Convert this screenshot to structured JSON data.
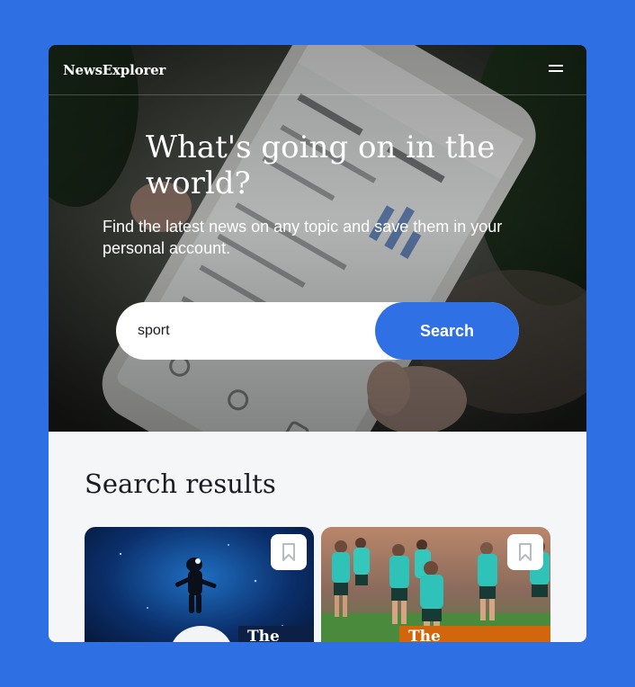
{
  "header": {
    "logo": "NewsExplorer",
    "menu_icon": "hamburger-menu-icon"
  },
  "hero": {
    "title": "What's going on in the world?",
    "subtitle": "Find the latest news on any topic and save them in your personal account."
  },
  "search": {
    "value": "sport",
    "button_label": "Search"
  },
  "results": {
    "title": "Search results",
    "cards": [
      {
        "bookmark_icon": "bookmark-icon",
        "source_tag": "The"
      },
      {
        "bookmark_icon": "bookmark-icon",
        "source_tag": "The"
      }
    ]
  },
  "colors": {
    "page_background": "#2f6fe4",
    "accent": "#2f71e5",
    "results_background": "#f5f6f7",
    "text_dark": "#1a1b22"
  }
}
